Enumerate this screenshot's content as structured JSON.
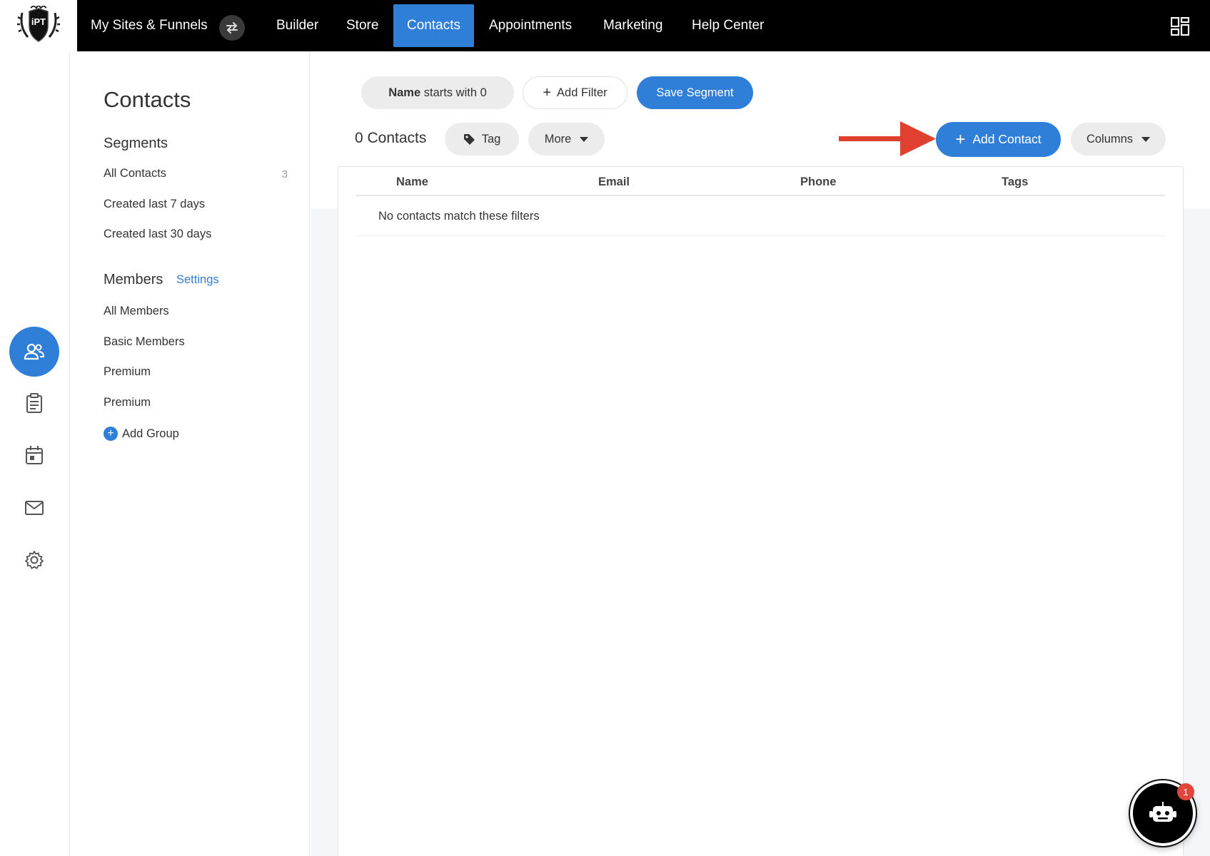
{
  "brand": {
    "logo_text": "iPT"
  },
  "topnav": {
    "sites_label": "My Sites & Funnels",
    "items": [
      "Builder",
      "Store",
      "Contacts",
      "Appointments",
      "Marketing",
      "Help Center"
    ],
    "active": "Contacts"
  },
  "sidebar": {
    "title": "Contacts",
    "segments_heading": "Segments",
    "segments": [
      {
        "label": "All Contacts",
        "count": "3"
      },
      {
        "label": "Created last 7 days"
      },
      {
        "label": "Created last 30 days"
      }
    ],
    "members_heading": "Members",
    "members_settings": "Settings",
    "members": [
      "All Members",
      "Basic Members",
      "Premium",
      "Premium"
    ],
    "add_group": "Add Group"
  },
  "filters": {
    "active_filter_field": "Name",
    "active_filter_rest": "starts with 0",
    "add_filter": "Add Filter",
    "save_segment": "Save Segment"
  },
  "toolbar": {
    "contacts_count": "0 Contacts",
    "tag": "Tag",
    "more": "More",
    "add_contact": "Add Contact",
    "columns": "Columns"
  },
  "table": {
    "headers": [
      "Name",
      "Email",
      "Phone",
      "Tags"
    ],
    "empty_message": "No contacts match these filters"
  },
  "chatbot": {
    "badge_count": "1"
  },
  "colors": {
    "accent": "#2f7fd8",
    "annotation_arrow": "#e0402f",
    "nav_bg": "#000000"
  }
}
